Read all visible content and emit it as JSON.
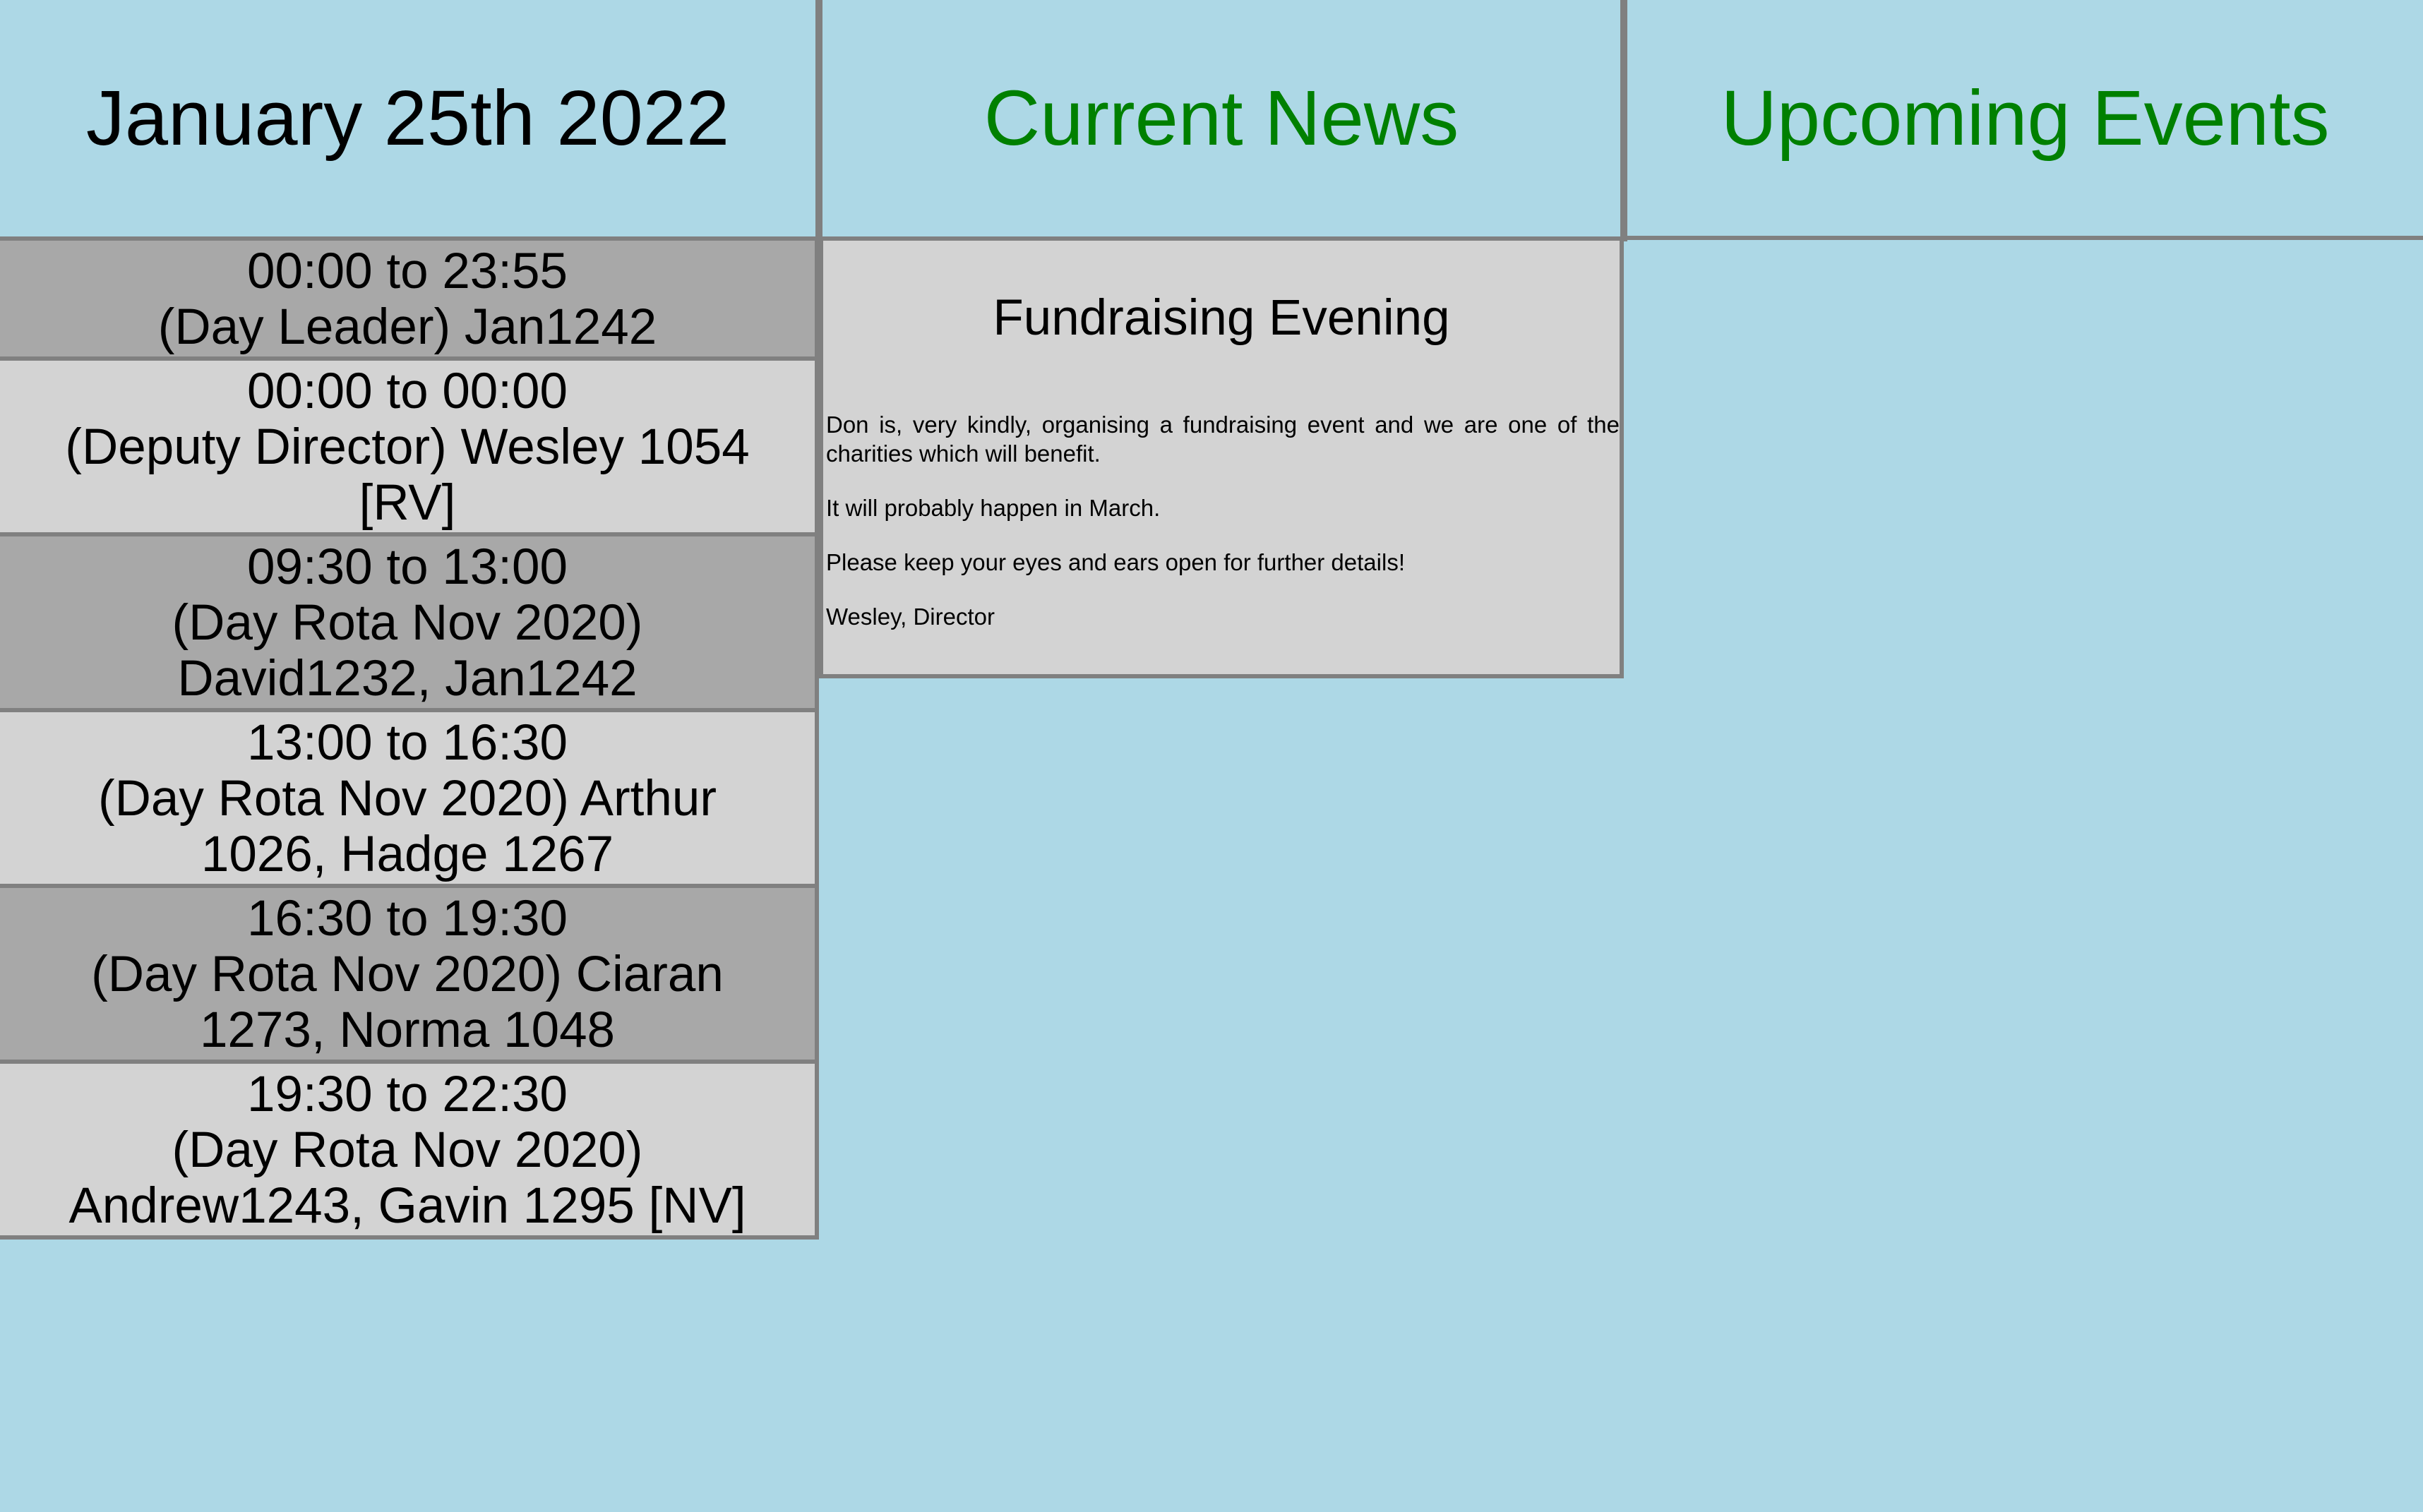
{
  "header": {
    "date": "January 25th 2022",
    "news_title": "Current News",
    "events_title": "Upcoming Events"
  },
  "rota": [
    {
      "time": "00:00 to 23:55",
      "detail": "(Day Leader) Jan1242"
    },
    {
      "time": "00:00 to 00:00",
      "detail": "(Deputy Director) Wesley 1054 [RV]"
    },
    {
      "time": "09:30 to 13:00",
      "detail": "(Day Rota Nov 2020) David1232, Jan1242"
    },
    {
      "time": "13:00 to 16:30",
      "detail": "(Day Rota Nov 2020) Arthur 1026, Hadge 1267"
    },
    {
      "time": "16:30 to 19:30",
      "detail": "(Day Rota Nov 2020) Ciaran 1273, Norma 1048"
    },
    {
      "time": "19:30 to 22:30",
      "detail": "(Day Rota Nov 2020) Andrew1243, Gavin 1295 [NV]"
    }
  ],
  "news": {
    "title": "Fundraising Evening",
    "paragraphs": [
      "Don is, very kindly, organising a fundraising event and we are one of the charities which will benefit.",
      "It will probably happen in March.",
      "Please keep your eyes and ears open for further details!",
      "Wesley, Director"
    ]
  },
  "colors": {
    "background": "#add8e6",
    "border": "#808080",
    "heading_green": "#008000",
    "row_dark": "#a8a8a8",
    "row_light": "#d3d3d3"
  }
}
